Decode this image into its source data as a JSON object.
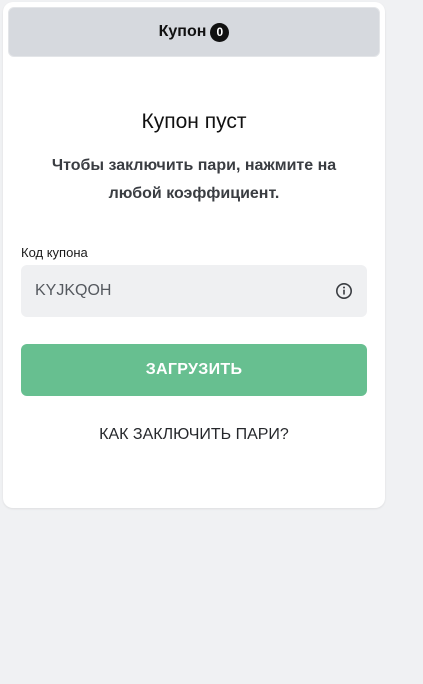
{
  "coupon_tab": {
    "label": "Купон",
    "count": "0"
  },
  "empty_state": {
    "title": "Купон пуст",
    "text": "Чтобы заключить пари, нажмите на любой коэффициент."
  },
  "coupon_code": {
    "label": "Код купона",
    "value": "KYJKQOH",
    "info_icon": "info-circle-icon"
  },
  "load_button": {
    "label": "ЗАГРУЗИТЬ"
  },
  "howto_link": {
    "label": "КАК ЗАКЛЮЧИТЬ ПАРИ?"
  },
  "colors": {
    "accent_green": "#67bf90",
    "tab_bg": "#d6d9de",
    "field_bg": "#eff0f2",
    "page_bg": "#f0f1f3"
  }
}
